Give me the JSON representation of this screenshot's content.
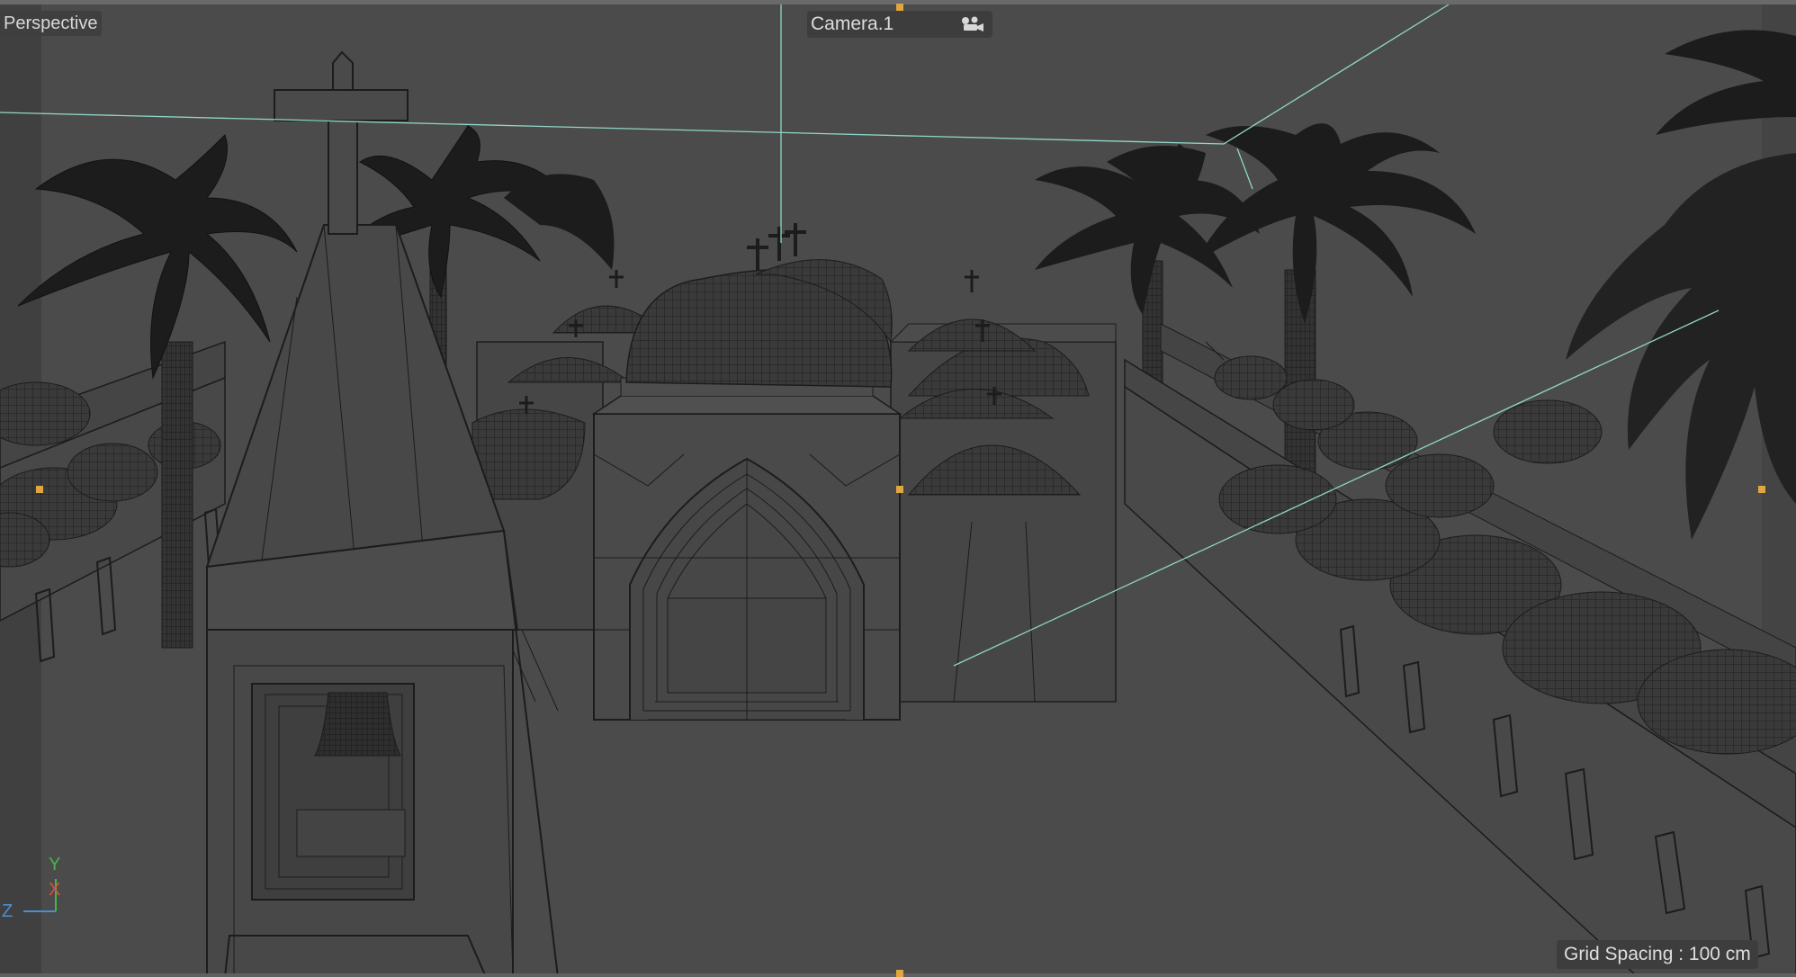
{
  "viewport": {
    "label": "Perspective",
    "camera_name": "Camera.1",
    "camera_icon": "camera-options-icon",
    "grid_info": "Grid Spacing : 100 cm",
    "axes": {
      "y": "Y",
      "x": "X",
      "z": "Z"
    }
  },
  "colors": {
    "viewport_bg": "#4b4b4b",
    "wire": "#1c1c1c",
    "guide_line": "#8fd6c8",
    "handle": "#e0a640",
    "axis_y": "#4bb34b",
    "axis_x": "#d9533b",
    "axis_z": "#4a8fd1"
  }
}
